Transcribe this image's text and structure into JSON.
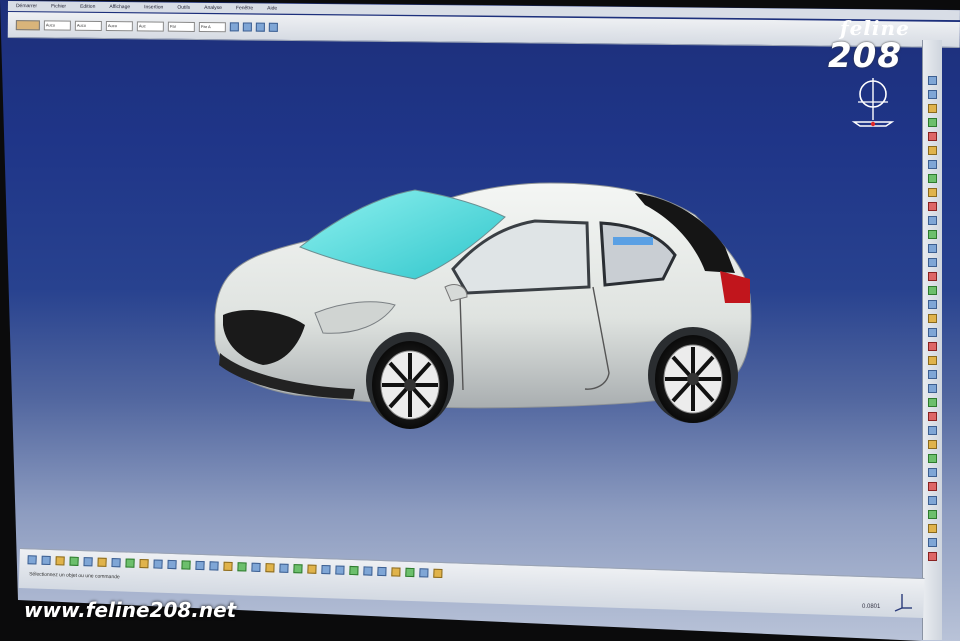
{
  "app": {
    "menus": [
      "Démarrer",
      "Fichier",
      "Edition",
      "Affichage",
      "Insertion",
      "Outils",
      "Analyse",
      "Fenêtre",
      "Aide"
    ],
    "status_text": "Sélectionnez un objet ou une commande",
    "scale_readout": "0.0801"
  },
  "toolbar_top": {
    "combos": [
      "Aucu",
      "Aucu",
      "Aucu",
      "Auc",
      "Par",
      "Par A"
    ]
  },
  "watermark": {
    "script": "feline",
    "number": "208",
    "url": "www.feline208.net"
  },
  "colors": {
    "viewport_top": "#1d2f7a",
    "viewport_bottom": "#b9c3d8",
    "car_body": "#e7ebe8",
    "glass": "#3fd3d6"
  }
}
